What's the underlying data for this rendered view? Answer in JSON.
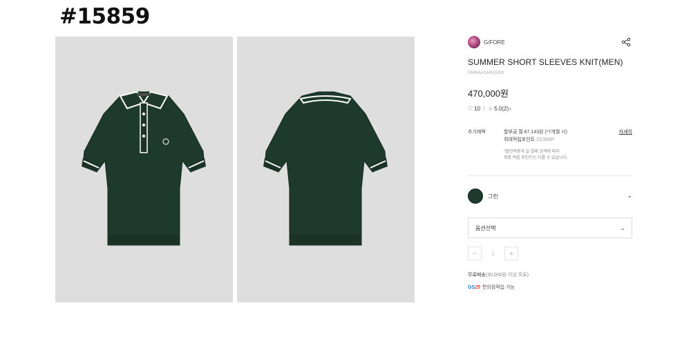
{
  "page_id": "#15859",
  "images": {
    "front_alt": "front view knit polo",
    "back_alt": "back view knit polo",
    "colors": {
      "background": "#dedede",
      "garment": "#1e3a2c",
      "trim": "#ffffff"
    }
  },
  "brand": {
    "name": "G/FORE"
  },
  "product": {
    "title": "SUMMER SHORT SLEEVES KNIT(MEN)",
    "code": "GMWAA24451GRX",
    "price": "470,000원",
    "likes": "10",
    "rating": "5.0",
    "reviews": "(2)"
  },
  "benefits": {
    "label": "추가혜택",
    "installment": "할부금 월 67,143원 (*7개월 시)",
    "points_label": "최대적립포인트",
    "points_value": "23,500P",
    "note_line1": "*할인적용과 실 결제 금액에 따라",
    "note_line2": "최종 적립 포인트는 다를 수 있습니다.",
    "detail_link": "자세히"
  },
  "color_option": {
    "name": "그린",
    "swatch": "#1e3a2c"
  },
  "option_select": {
    "placeholder": "옵션선택"
  },
  "quantity": {
    "minus": "−",
    "value": "1",
    "plus": "+"
  },
  "shipping": {
    "label": "무료배송",
    "condition": "(30,000원 이상 무료)"
  },
  "gs25": {
    "logo_gs": "GS",
    "logo_num": "25",
    "text": "편의점픽업 가능"
  }
}
